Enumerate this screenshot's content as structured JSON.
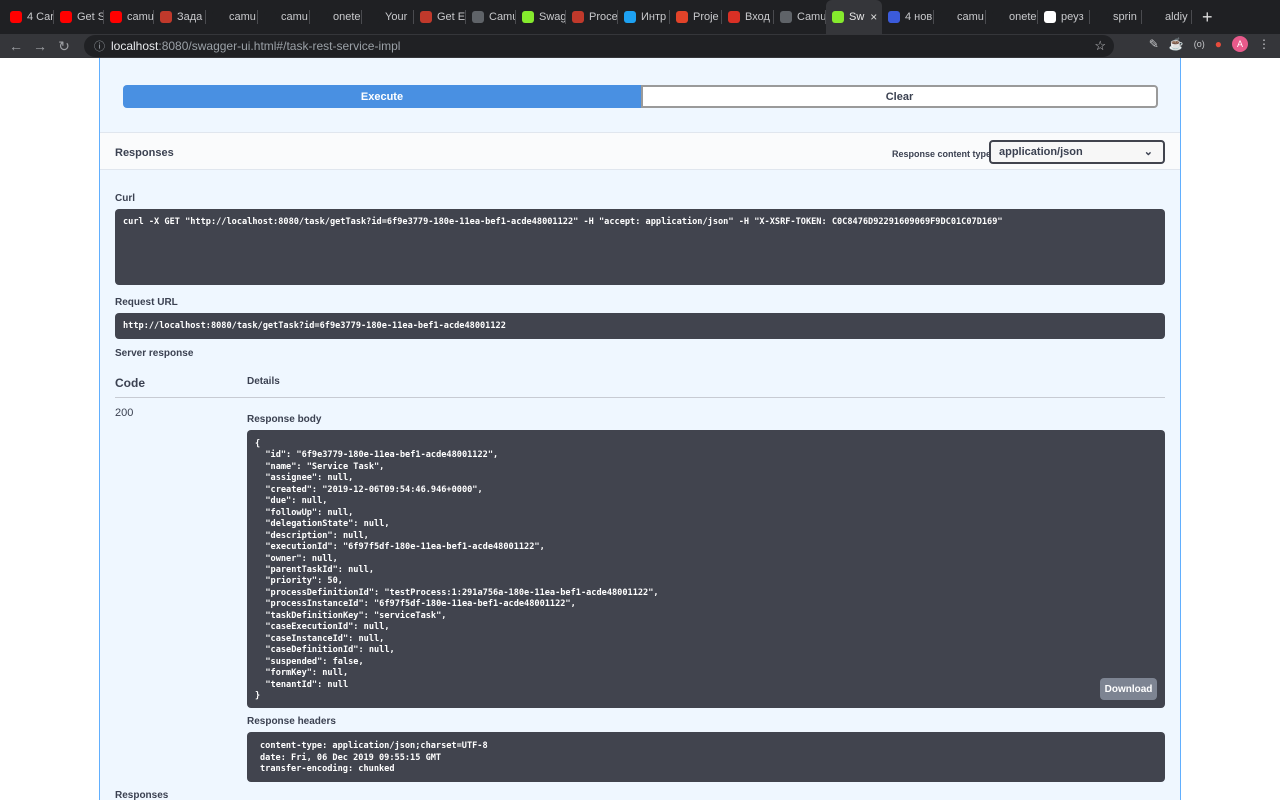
{
  "browser": {
    "tabs": [
      {
        "label": "4 Car",
        "icon": "youtube-icon",
        "color": "#ff0000"
      },
      {
        "label": "Get S",
        "icon": "youtube-icon",
        "color": "#ff0000"
      },
      {
        "label": "camu",
        "icon": "youtube-icon",
        "color": "#ff0000"
      },
      {
        "label": "Зада",
        "icon": "app-icon",
        "color": "#c0392b"
      },
      {
        "label": "camu",
        "icon": "github-icon",
        "color": "#1f2023"
      },
      {
        "label": "camu",
        "icon": "github-icon",
        "color": "#1f2023"
      },
      {
        "label": "onete",
        "icon": "github-icon",
        "color": "#1f2023"
      },
      {
        "label": "Your",
        "icon": "github-icon",
        "color": "#1f2023"
      },
      {
        "label": "Get E",
        "icon": "app-icon",
        "color": "#c0392b"
      },
      {
        "label": "Camu",
        "icon": "globe-icon",
        "color": "#5f6368"
      },
      {
        "label": "Swag",
        "icon": "swagger-icon",
        "color": "#85ea2d"
      },
      {
        "label": "Proce",
        "icon": "app-icon",
        "color": "#c0392b"
      },
      {
        "label": "Интр",
        "icon": "b-icon",
        "color": "#1da1f2"
      },
      {
        "label": "Proje",
        "icon": "gitlab-icon",
        "color": "#e24329"
      },
      {
        "label": "Вход",
        "icon": "mail-icon",
        "color": "#d93025"
      },
      {
        "label": "Camu",
        "icon": "globe-icon",
        "color": "#5f6368"
      },
      {
        "label": "Sw",
        "icon": "swagger-icon",
        "color": "#85ea2d",
        "active": true
      },
      {
        "label": "4 нов",
        "icon": "at-icon",
        "color": "#3b5bdb"
      },
      {
        "label": "camu",
        "icon": "github-icon",
        "color": "#1f2023"
      },
      {
        "label": "onete",
        "icon": "github-icon",
        "color": "#1f2023"
      },
      {
        "label": "реуз",
        "icon": "google-icon",
        "color": "#ffffff"
      },
      {
        "label": "sprin",
        "icon": "github-icon",
        "color": "#1f2023"
      },
      {
        "label": "aldiy",
        "icon": "github-icon",
        "color": "#1f2023"
      }
    ],
    "new_tab": "+",
    "url_host": "localhost",
    "url_rest": ":8080/swagger-ui.html#/task-rest-service-impl",
    "avatar_letter": "A"
  },
  "execute": {
    "execute_label": "Execute",
    "clear_label": "Clear"
  },
  "responses": {
    "title": "Responses",
    "content_type_label": "Response content type",
    "content_type_value": "application/json"
  },
  "curl": {
    "label": "Curl",
    "command": "curl -X GET \"http://localhost:8080/task/getTask?id=6f9e3779-180e-11ea-bef1-acde48001122\" -H \"accept: application/json\" -H \"X-XSRF-TOKEN: C0C8476D92291609069F9DC01C07D169\""
  },
  "request_url": {
    "label": "Request URL",
    "value": "http://localhost:8080/task/getTask?id=6f9e3779-180e-11ea-bef1-acde48001122"
  },
  "server_response": {
    "label": "Server response",
    "col_code": "Code",
    "col_details": "Details",
    "code": "200",
    "body_label": "Response body",
    "body_lines": [
      "{",
      "  \"id\": \"6f9e3779-180e-11ea-bef1-acde48001122\",",
      "  \"name\": \"Service Task\",",
      "  \"assignee\": null,",
      "  \"created\": \"2019-12-06T09:54:46.946+0000\",",
      "  \"due\": null,",
      "  \"followUp\": null,",
      "  \"delegationState\": null,",
      "  \"description\": null,",
      "  \"executionId\": \"6f97f5df-180e-11ea-bef1-acde48001122\",",
      "  \"owner\": null,",
      "  \"parentTaskId\": null,",
      "  \"priority\": 50,",
      "  \"processDefinitionId\": \"testProcess:1:291a756a-180e-11ea-bef1-acde48001122\",",
      "  \"processInstanceId\": \"6f97f5df-180e-11ea-bef1-acde48001122\",",
      "  \"taskDefinitionKey\": \"serviceTask\",",
      "  \"caseExecutionId\": null,",
      "  \"caseInstanceId\": null,",
      "  \"caseDefinitionId\": null,",
      "  \"suspended\": false,",
      "  \"formKey\": null,",
      "  \"tenantId\": null",
      "}"
    ],
    "download_label": "Download",
    "headers_label": "Response headers",
    "header_lines": [
      "content-type: application/json;charset=UTF-8",
      "date: Fri, 06 Dec 2019 09:55:15 GMT",
      "transfer-encoding: chunked"
    ]
  },
  "bottom_label": "Responses"
}
